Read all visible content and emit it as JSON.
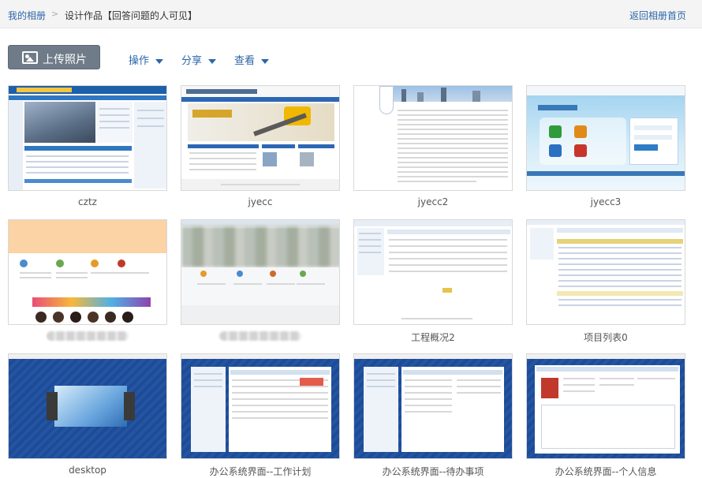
{
  "breadcrumb": {
    "home": "我的相册",
    "separator": ">",
    "current": "设计作品【回答问题的人可见】",
    "back": "返回相册首页"
  },
  "toolbar": {
    "upload": "上传照片",
    "operate": "操作",
    "share": "分享",
    "view": "查看"
  },
  "photos": [
    {
      "caption": "cztz"
    },
    {
      "caption": "jyecc"
    },
    {
      "caption": "jyecc2"
    },
    {
      "caption": "jyecc3"
    },
    {
      "caption": ""
    },
    {
      "caption": ""
    },
    {
      "caption": "工程概况2"
    },
    {
      "caption": "项目列表0"
    },
    {
      "caption": "desktop"
    },
    {
      "caption": "办公系统界面--工作计划"
    },
    {
      "caption": "办公系统界面--待办事项"
    },
    {
      "caption": "办公系统界面--个人信息"
    }
  ],
  "colors": {
    "link": "#2b66a8",
    "upload_bg": "#6f7b88",
    "topbar_bg": "#f4f4f4"
  }
}
